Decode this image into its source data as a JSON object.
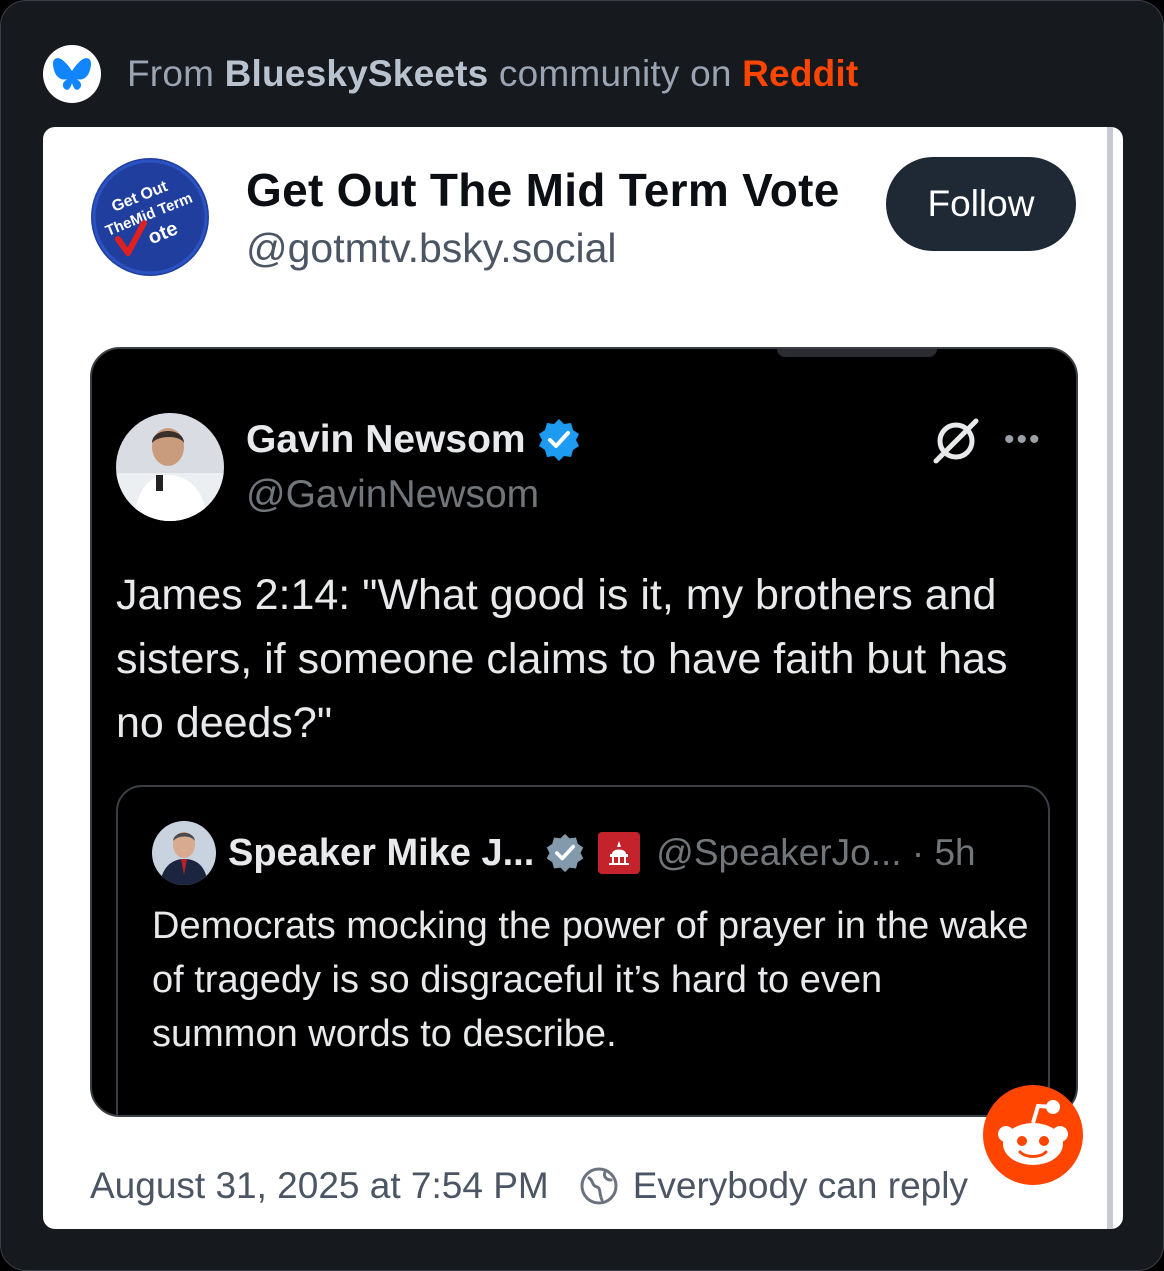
{
  "source": {
    "prefix": "From",
    "community": "BlueskySkeets",
    "middle": "community on",
    "platform": "Reddit",
    "logo_icon": "bluesky-butterfly-icon"
  },
  "post": {
    "author_name": "Get Out The Mid Term Vote",
    "author_handle": "@gotmtv.bsky.social",
    "follow_label": "Follow",
    "avatar": {
      "line1": "Get Out",
      "line2": "TheMid Term",
      "line3": "ote"
    },
    "timestamp": "August 31, 2025 at 7:54 PM",
    "reply_setting": "Everybody can reply"
  },
  "tweet": {
    "name": "Gavin Newsom",
    "handle": "@GavinNewsom",
    "body": "James 2:14: \"What good is it, my brothers and sisters, if someone claims to have faith but has no deeds?\"",
    "more_label": "•••"
  },
  "quote": {
    "name": "Speaker Mike J...",
    "handle": "@SpeakerJo... · 5h",
    "body": "Democrats mocking the power of prayer in the wake of tragedy is so disgraceful it’s hard to even summon words to describe."
  },
  "colors": {
    "reddit": "#ff4500",
    "bluesky": "#1185fe",
    "follow_bg": "#1e2935",
    "verified": "#1d9bf0"
  }
}
